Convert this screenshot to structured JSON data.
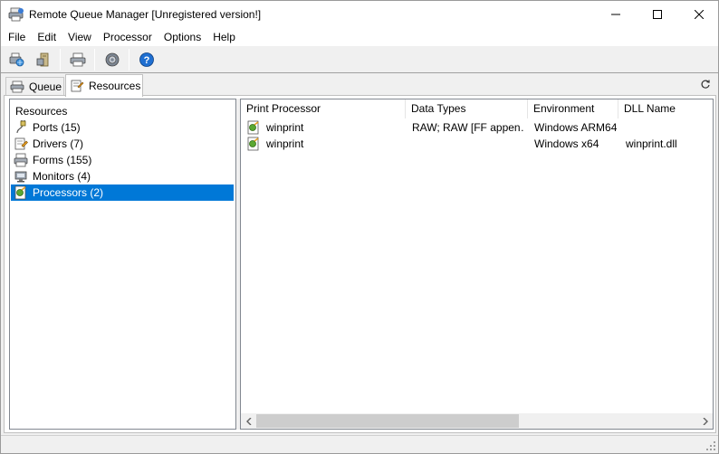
{
  "window": {
    "title": "Remote Queue Manager [Unregistered version!]",
    "controls": {
      "minimize": "—",
      "maximize": "☐",
      "close": "✕"
    }
  },
  "menu": {
    "items": [
      "File",
      "Edit",
      "View",
      "Processor",
      "Options",
      "Help"
    ]
  },
  "toolbar": {
    "buttons": [
      "connect-icon",
      "server-icon",
      "printer-icon",
      "settings-gear-icon",
      "help-icon"
    ]
  },
  "tabs": {
    "items": [
      {
        "label": "Queue",
        "icon": "printer-icon",
        "active": false
      },
      {
        "label": "Resources",
        "icon": "resources-icon",
        "active": true
      }
    ]
  },
  "tree": {
    "root": "Resources",
    "items": [
      {
        "label": "Ports (15)",
        "icon": "port-plug-icon",
        "selected": false
      },
      {
        "label": "Drivers (7)",
        "icon": "driver-icon",
        "selected": false
      },
      {
        "label": "Forms (155)",
        "icon": "forms-icon",
        "selected": false
      },
      {
        "label": "Monitors (4)",
        "icon": "monitor-icon",
        "selected": false
      },
      {
        "label": "Processors (2)",
        "icon": "processor-icon",
        "selected": true
      }
    ]
  },
  "list": {
    "columns": [
      "Print Processor",
      "Data Types",
      "Environment",
      "DLL Name"
    ],
    "rows": [
      {
        "processor": "winprint",
        "data_types": "RAW; RAW [FF appen…",
        "environment": "Windows ARM64",
        "dll": ""
      },
      {
        "processor": "winprint",
        "data_types": "",
        "environment": "Windows x64",
        "dll": "winprint.dll"
      }
    ]
  },
  "colors": {
    "selection": "#0078d7",
    "window_bg": "#f0f0f0",
    "panel_bg": "#ffffff"
  }
}
